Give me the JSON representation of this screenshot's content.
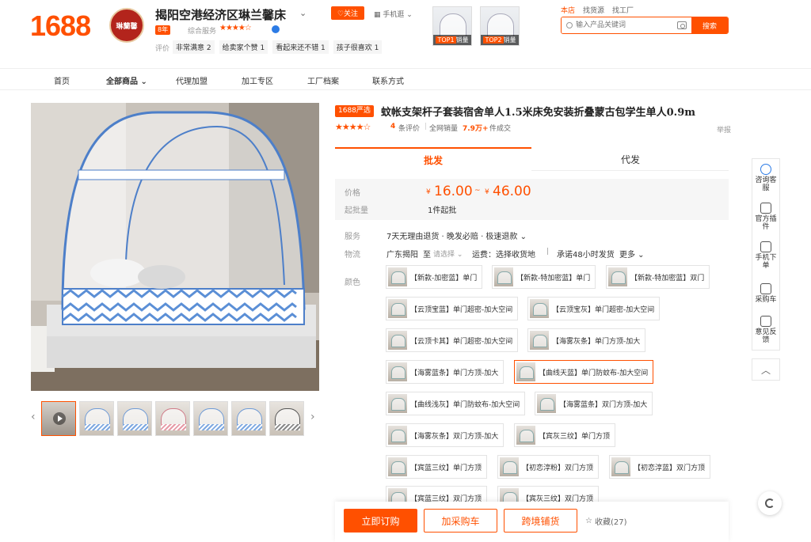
{
  "header": {
    "logo": "1688",
    "store_name": "揭阳空港经济区琳兰馨床",
    "store_logo_text": "琳蘭馨",
    "follow_label": "♡关注",
    "mobile_label": "手机逛 ⌄",
    "years_badge": "8年",
    "rating_label": "综合服务",
    "rating_stars": "★★★★☆",
    "reviews_label": "评价",
    "review_tags": [
      "非常满意 2",
      "给卖家个赞 1",
      "看起来还不错 1",
      "孩子很喜欢 1"
    ],
    "top_products": [
      {
        "rank": "TOP1",
        "label": "销量"
      },
      {
        "rank": "TOP2",
        "label": "销量"
      }
    ],
    "search_tabs": [
      "本店",
      "找货源",
      "找工厂"
    ],
    "search_placeholder": "输入产品关键词",
    "search_button": "搜索"
  },
  "nav": [
    "首页",
    "全部商品",
    "代理加盟",
    "加工专区",
    "工厂档案",
    "联系方式"
  ],
  "product": {
    "badge": "1688严选",
    "title": "蚊帐支架杆子套装宿舍单人1.5米床免安装折叠蒙古包学生单人0.9m",
    "stars": "★★★★☆",
    "review_count": "4",
    "review_label": "条评价",
    "sales_label": "全网销量",
    "sales_value": "7.9万+",
    "sales_unit": "件成交",
    "report": "举报"
  },
  "tabs": [
    "批发",
    "代发"
  ],
  "price": {
    "label": "价格",
    "currency": "¥",
    "low": "16.00",
    "sep": "~",
    "high": "46.00",
    "moq_label": "起批量",
    "moq": "1件起批"
  },
  "service": {
    "label": "服务",
    "value": "7天无理由退货 · 晚发必赔 · 极速退款 ⌄"
  },
  "logistics": {
    "label": "物流",
    "from": "广东揭阳",
    "to": "至",
    "choose": "请选择 ⌄",
    "fee": "运费：选择收货地",
    "promise": "承诺48小时发货",
    "more": "更多 ⌄"
  },
  "colors": {
    "label": "颜色",
    "options": [
      "【新款-加密蓝】单门",
      "【新款-特加密蓝】单门",
      "【新款-特加密蓝】双门",
      "【云顶宝蓝】单门超密-加大空间",
      "【云顶宝灰】单门超密-加大空间",
      "【云顶卡其】单门超密-加大空间",
      "【海雾灰条】单门方顶-加大",
      "【海雾蓝条】单门方顶-加大",
      "【曲线天蓝】单门防蚊布-加大空间",
      "【曲线浅灰】单门防蚊布-加大空间",
      "【海雾蓝条】双门方顶-加大",
      "【海雾灰条】双门方顶-加大",
      "【宾灰三纹】单门方顶",
      "【宾蓝三纹】单门方顶",
      "【初恋淳粉】双门方顶",
      "【初恋淳蓝】双门方顶",
      "【宾蓝三纹】双门方顶",
      "【宾灰三纹】双门方顶"
    ]
  },
  "actions": {
    "buy": "立即订购",
    "cart": "加采购车",
    "cross": "跨境铺货",
    "fav": "收藏(27)"
  },
  "sidebar": [
    {
      "label": "咨询客服",
      "icon": "chat-icon"
    },
    {
      "label": "官方插件",
      "icon": "plugin-icon"
    },
    {
      "label": "手机下单",
      "icon": "qr-icon"
    },
    {
      "label": "采购车",
      "icon": "cart-icon"
    },
    {
      "label": "意见反馈",
      "icon": "edit-icon"
    }
  ],
  "accent_color": "#ff5000"
}
